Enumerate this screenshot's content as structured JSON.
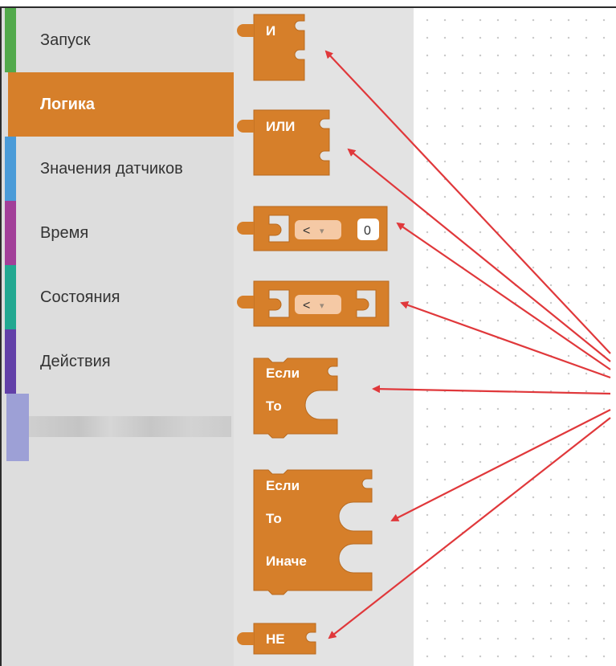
{
  "sidebar": {
    "categories": [
      {
        "label": "Запуск",
        "color": "#52a94b",
        "selected": false
      },
      {
        "label": "Логика",
        "color": "#d67f2a",
        "selected": true
      },
      {
        "label": "Значения датчиков",
        "color": "#4a9bd8",
        "selected": false
      },
      {
        "label": "Время",
        "color": "#a23f99",
        "selected": false
      },
      {
        "label": "Состояния",
        "color": "#22a891",
        "selected": false
      },
      {
        "label": "Действия",
        "color": "#6240a8",
        "selected": false
      }
    ]
  },
  "blocks": {
    "and": {
      "label": "И"
    },
    "or": {
      "label": "ИЛИ"
    },
    "compare_number": {
      "operator": "<",
      "value": "0"
    },
    "compare": {
      "operator": "<"
    },
    "if_then": {
      "if_label": "Если",
      "then_label": "То"
    },
    "if_then_else": {
      "if_label": "Если",
      "then_label": "То",
      "else_label": "Иначе"
    },
    "not": {
      "label": "НЕ"
    }
  },
  "colors": {
    "block": "#d67f2a",
    "block_dark": "#b86a1f",
    "dropdown_bg": "#f5c9a5",
    "arrow": "#e0383b",
    "sidebar_bg": "#dddddd",
    "flyout_bg": "#e3e3e3"
  }
}
